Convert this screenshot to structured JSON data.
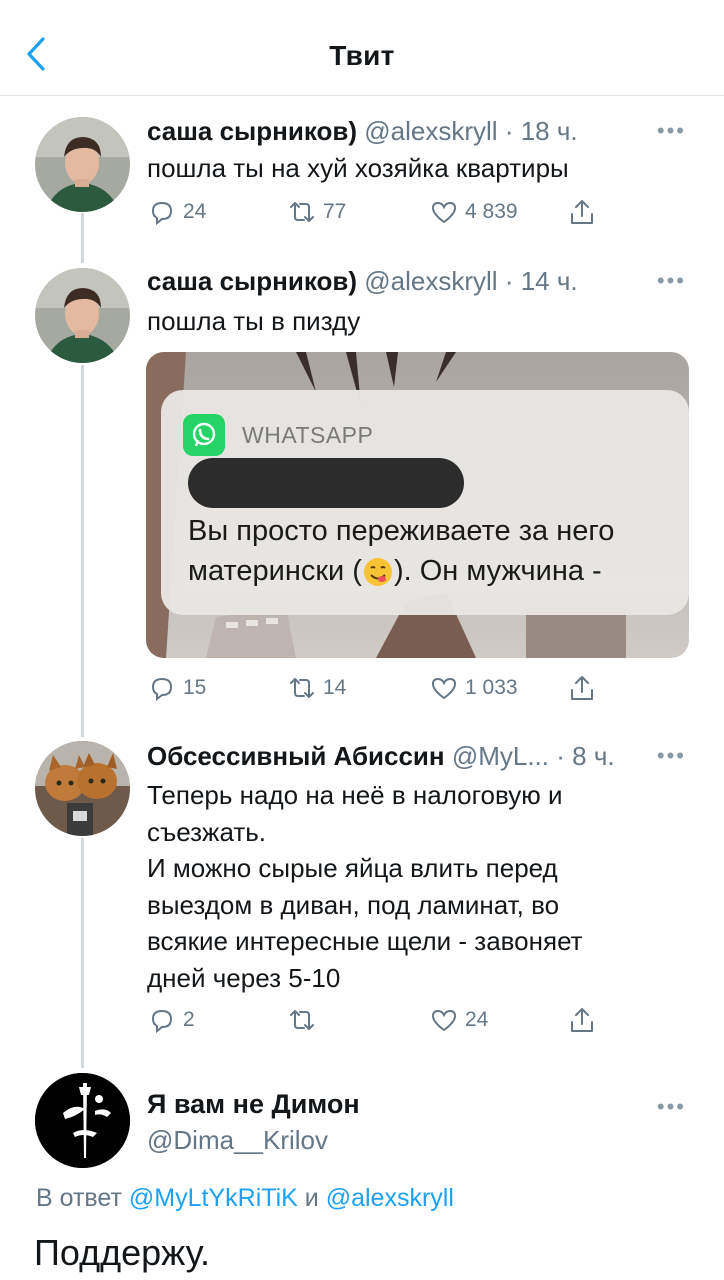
{
  "header": {
    "title": "Твит"
  },
  "tweets": [
    {
      "name": "саша сырников)",
      "handle": "@alexskryll",
      "dot": "·",
      "time": "18 ч.",
      "text": "пошла ты на хуй хозяйка квартиры",
      "stats": {
        "replies": "24",
        "retweets": "77",
        "likes": "4 839"
      }
    },
    {
      "name": "саша сырников)",
      "handle": "@alexskryll",
      "dot": "·",
      "time": "14 ч.",
      "text": "пошла ты в пизду",
      "stats": {
        "replies": "15",
        "retweets": "14",
        "likes": "1 033"
      },
      "media": {
        "app_name": "WHATSAPP",
        "message_line1": "Вы просто переживаете за него",
        "message_line2_before": "матерински (",
        "message_line2_after": "). Он мужчина -"
      }
    },
    {
      "name": "Обсессивный Абиссин",
      "handle": "@MyL...",
      "dot": "·",
      "time": "8 ч.",
      "text_lines": [
        "Теперь надо на неё в налоговую и",
        "съезжать.",
        "И можно сырые яйца влить перед",
        "выездом в диван, под ламинат, во",
        "всякие интересные щели - завоняет",
        "дней через 5-10"
      ],
      "stats": {
        "replies": "2",
        "retweets": "",
        "likes": "24"
      }
    }
  ],
  "main_tweet": {
    "name": "Я вам не Димон",
    "handle": "@Dima__Krilov",
    "reply_prefix": "В ответ",
    "reply_mention1": "@MyLtYkRiTiK",
    "reply_and": "и",
    "reply_mention2": "@alexskryll",
    "text": "Поддержу."
  },
  "icons": {
    "back": "chevron-left-icon",
    "more": "more-dots-icon",
    "reply": "reply-bubble-icon",
    "retweet": "retweet-icon",
    "like": "heart-icon",
    "share": "share-icon",
    "whatsapp": "whatsapp-logo-icon",
    "emoji": "savoring-face-emoji-icon"
  },
  "colors": {
    "accent": "#1da1f2",
    "secondary_text": "#657786",
    "whatsapp_green": "#25d366"
  }
}
